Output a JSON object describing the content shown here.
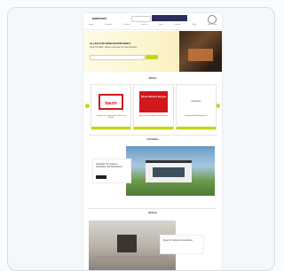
{
  "header": {
    "logo": "bahnhof",
    "nav_items": [
      "Home",
      "Produkte",
      "Marken",
      "Service",
      "Ideen",
      "Kontakt",
      "Blog",
      "Mein Konto"
    ]
  },
  "hero": {
    "title": "ALLES FÜR DEIN BAUPROJEKT",
    "subtitle": "Finde Produkte, Marken und Ideen für dein Zuhause",
    "search_placeholder": "",
    "button_label": ""
  },
  "brands": {
    "title": "Marken",
    "cards": [
      {
        "logo_text": "baum",
        "desc": "Produkte und Lösungen für Haus und Garten"
      },
      {
        "logo_text": "Bauen Wohnen Energie",
        "desc": "Alles rund ums Bauen und Wohnen"
      },
      {
        "logo_text": "Anbieter",
        "desc": "Ausgewählte Markenpartner"
      }
    ]
  },
  "feature": {
    "title": "Architektur",
    "promo_text": "Inspiration für moderne Architektur und Wohnräume",
    "button_label": ""
  },
  "interior": {
    "title": "Wohnen",
    "text": "Ideen für moderne Innenräume"
  },
  "footer": {
    "text": ""
  },
  "colors": {
    "accent": "#c8d616",
    "brand_red": "#d2171d"
  }
}
